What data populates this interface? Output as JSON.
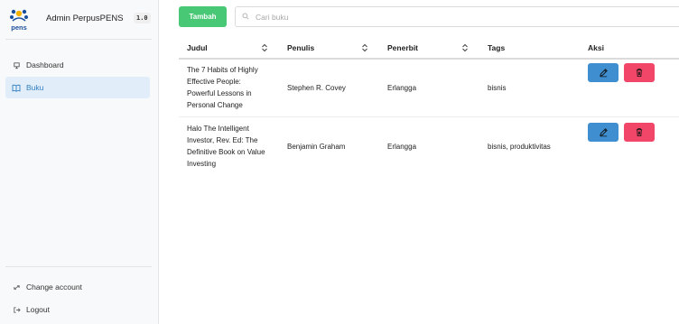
{
  "sidebar": {
    "brand_title": "Admin PerpusPENS",
    "logo_text": "pens",
    "version": "1.0",
    "nav": [
      {
        "label": "Dashboard",
        "icon": "dashboard-icon"
      },
      {
        "label": "Buku",
        "icon": "book-icon",
        "active": true
      }
    ],
    "footer": [
      {
        "label": "Change account",
        "icon": "switch-account-icon"
      },
      {
        "label": "Logout",
        "icon": "logout-icon"
      }
    ]
  },
  "toolbar": {
    "add_label": "Tambah",
    "search_placeholder": "Cari buku",
    "search_value": ""
  },
  "table": {
    "headers": {
      "judul": "Judul",
      "penulis": "Penulis",
      "penerbit": "Penerbit",
      "tags": "Tags",
      "aksi": "Aksi"
    },
    "rows": [
      {
        "judul": [
          "The 7 Habits of Highly",
          "Effective People:",
          "Powerful Lessons in",
          "Personal Change"
        ],
        "penulis": "Stephen R. Covey",
        "penerbit": "Erlangga",
        "tags": "bisnis"
      },
      {
        "judul": [
          "Halo The Intelligent",
          "Investor, Rev. Ed: The",
          "Definitive Book on Value",
          "Investing"
        ],
        "penulis": "Benjamin Graham",
        "penerbit": "Erlangga",
        "tags": "bisnis, produktivitas"
      }
    ]
  },
  "colors": {
    "primary_add": "#48c774",
    "edit": "#3e8ed0",
    "delete": "#f14668",
    "active_nav_bg": "#e1eef9",
    "active_nav_text": "#2f7ec1"
  }
}
